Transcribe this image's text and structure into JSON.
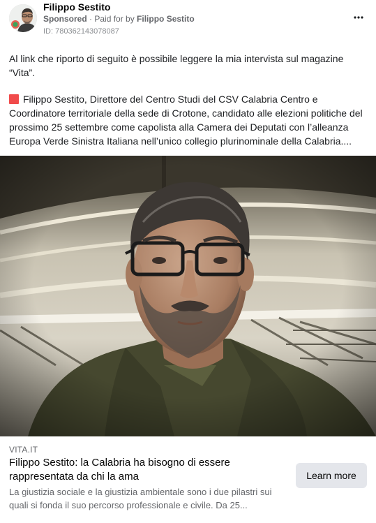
{
  "ad": {
    "author_name": "Filippo Sestito",
    "sponsored_label": "Sponsored",
    "separator": " · ",
    "paid_prefix": "Paid for by ",
    "paid_by": "Filippo Sestito",
    "ad_id": "ID: 780362143078087",
    "more_icon": "more-horizontal-icon"
  },
  "post": {
    "paragraph1": "Al link che riporto di seguito è possibile leggere la mia intervista sul magazine “Vita”.",
    "paragraph2": "Filippo Sestito, Direttore del Centro Studi del CSV Calabria Centro e Coordinatore territoriale della sede di Crotone, candidato alle elezioni politiche del prossimo 25 settembre come capolista alla Camera dei Deputati con l’alleanza Europa Verde Sinistra Italiana nell’unico collegio plurinominale della Calabria....",
    "bullet_color": "#f14b4b"
  },
  "link_preview": {
    "domain": "VITA.IT",
    "headline": "Filippo Sestito: la Calabria ha bisogno di essere rappresentata da chi la ama",
    "description": "La giustizia sociale e la giustizia ambientale sono i due pilastri sui quali si fonda il suo percorso professionale e civile. Da 25...",
    "cta_label": "Learn more"
  },
  "colors": {
    "secondary_text": "#65676b",
    "button_bg": "#e4e6eb"
  }
}
